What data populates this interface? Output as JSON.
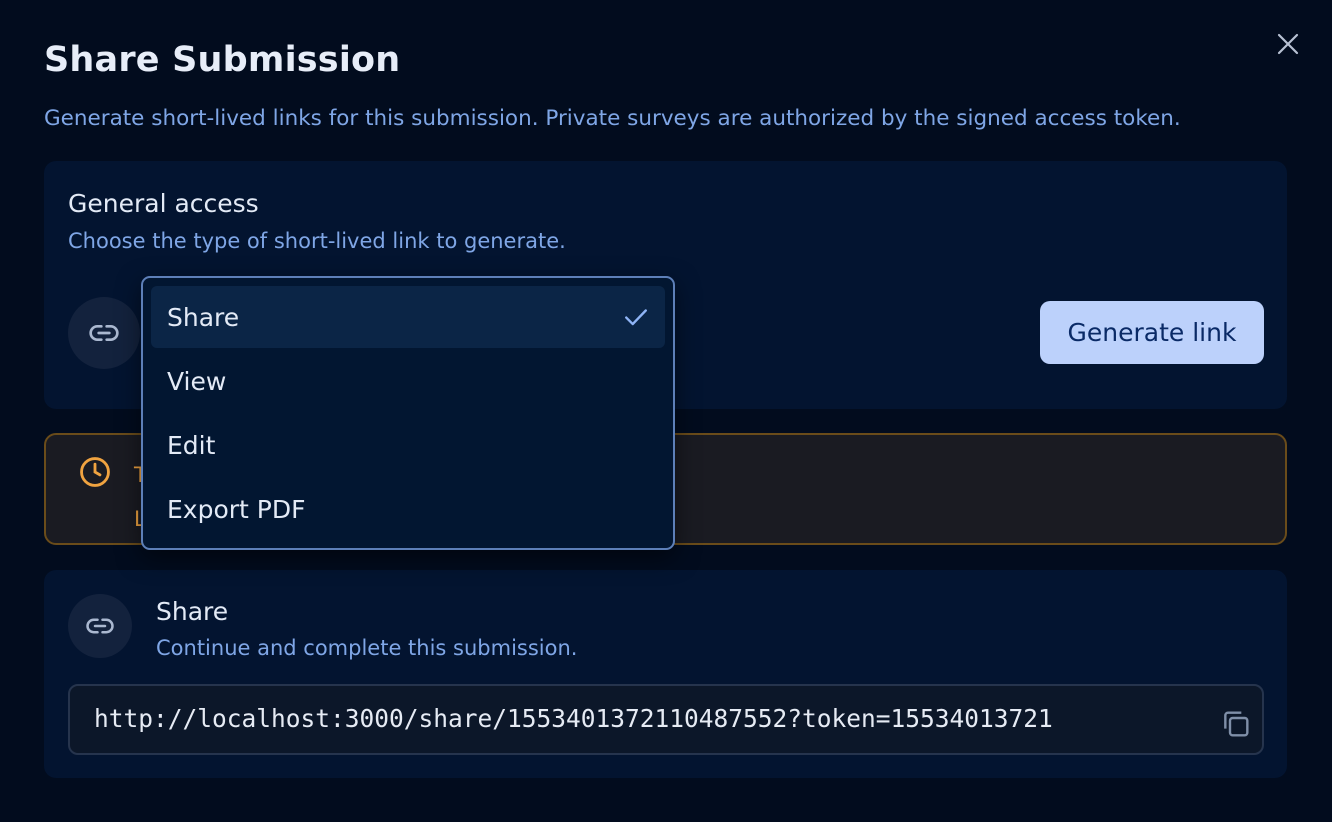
{
  "dialog": {
    "title": "Share Submission",
    "subtitle": "Generate short-lived links for this submission. Private surveys are authorized by the signed access token.",
    "close_label": "×"
  },
  "general_access": {
    "heading": "General access",
    "description": "Choose the type of short-lived link to generate.",
    "generate_button": "Generate link"
  },
  "dropdown": {
    "selected": "Share",
    "options": [
      {
        "label": "Share",
        "selected": true
      },
      {
        "label": "View",
        "selected": false
      },
      {
        "label": "Edit",
        "selected": false
      },
      {
        "label": "Export PDF",
        "selected": false
      }
    ]
  },
  "warning": {
    "line1": "T",
    "line2": "L"
  },
  "share_link": {
    "heading": "Share",
    "description": "Continue and complete this submission.",
    "url": "http://localhost:3000/share/1553401372110487552?token=15534013721"
  },
  "colors": {
    "background": "#020c1e",
    "card": "#031430",
    "accent_button": "#bcd1fb",
    "warning_text": "#f0a340",
    "muted_text": "#7fa6e6"
  },
  "icons": {
    "close": "close-icon",
    "link": "link-icon",
    "clock": "clock-icon",
    "check": "check-icon",
    "copy": "copy-icon"
  }
}
